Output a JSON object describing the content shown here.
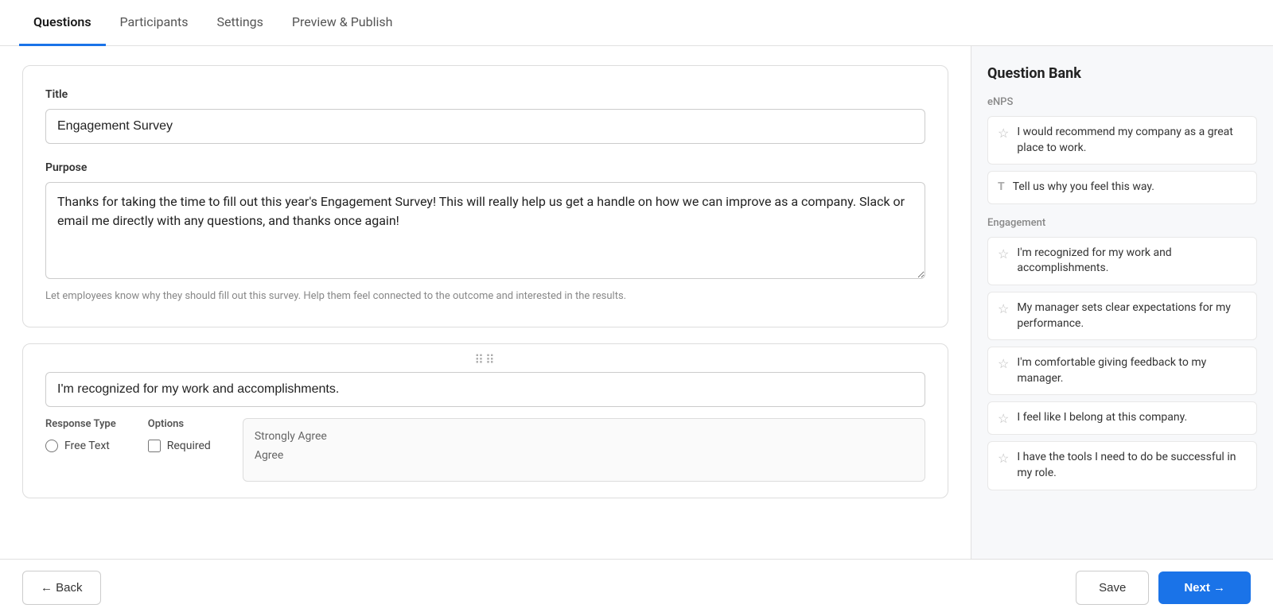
{
  "nav": {
    "tabs": [
      {
        "id": "questions",
        "label": "Questions",
        "active": true
      },
      {
        "id": "participants",
        "label": "Participants",
        "active": false
      },
      {
        "id": "settings",
        "label": "Settings",
        "active": false
      },
      {
        "id": "preview-publish",
        "label": "Preview & Publish",
        "active": false
      }
    ]
  },
  "survey": {
    "title_label": "Title",
    "title_value": "Engagement Survey",
    "purpose_label": "Purpose",
    "purpose_value": "Thanks for taking the time to fill out this year's Engagement Survey! This will really help us get a handle on how we can improve as a company. Slack or email me directly with any questions, and thanks once again!",
    "purpose_hint": "Let employees know why they should fill out this survey. Help them feel connected to the outcome and interested in the results."
  },
  "question_card": {
    "drag_handle": "⠿",
    "question_text": "I'm recognized for my work and accomplishments.",
    "response_type_label": "Response Type",
    "response_type_option": "Free Text",
    "options_label": "Options",
    "required_label": "Required",
    "scale_options": [
      "Strongly Agree",
      "Agree"
    ]
  },
  "bottom_bar": {
    "back_label": "← Back",
    "save_label": "Save",
    "next_label": "Next →"
  },
  "question_bank": {
    "title": "Question Bank",
    "sections": [
      {
        "id": "enps",
        "label": "eNPS",
        "items": [
          {
            "icon_type": "star",
            "text": "I would recommend my company as a great place to work."
          },
          {
            "icon_type": "text",
            "text": "Tell us why you feel this way."
          }
        ]
      },
      {
        "id": "engagement",
        "label": "Engagement",
        "items": [
          {
            "icon_type": "star",
            "text": "I'm recognized for my work and accomplishments."
          },
          {
            "icon_type": "star",
            "text": "My manager sets clear expectations for my performance."
          },
          {
            "icon_type": "star",
            "text": "I'm comfortable giving feedback to my manager."
          },
          {
            "icon_type": "star",
            "text": "I feel like I belong at this company."
          },
          {
            "icon_type": "star",
            "text": "I have the tools I need to do be successful in my role."
          }
        ]
      }
    ]
  }
}
